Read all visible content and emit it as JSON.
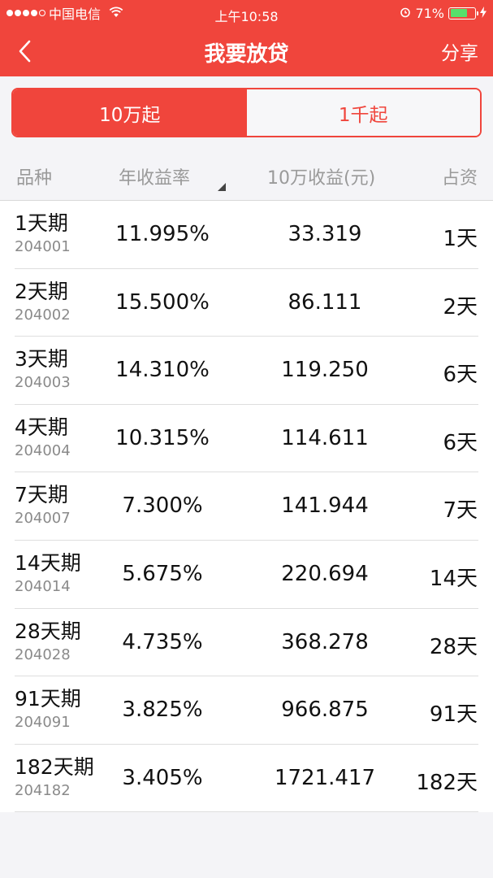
{
  "status_bar": {
    "carrier": "中国电信",
    "time": "上午10:58",
    "battery_percent": "71%",
    "battery_level": 0.71
  },
  "nav": {
    "title": "我要放贷",
    "share_label": "分享"
  },
  "segments": [
    {
      "label": "10万起",
      "active": true
    },
    {
      "label": "1千起",
      "active": false
    }
  ],
  "table": {
    "headers": {
      "variety": "品种",
      "annual_yield": "年收益率",
      "income_100k": "10万收益(元)",
      "duration": "占资"
    },
    "rows": [
      {
        "name": "1天期",
        "code": "204001",
        "rate": "11.995%",
        "income": "33.319",
        "days": "1天"
      },
      {
        "name": "2天期",
        "code": "204002",
        "rate": "15.500%",
        "income": "86.111",
        "days": "2天"
      },
      {
        "name": "3天期",
        "code": "204003",
        "rate": "14.310%",
        "income": "119.250",
        "days": "6天"
      },
      {
        "name": "4天期",
        "code": "204004",
        "rate": "10.315%",
        "income": "114.611",
        "days": "6天"
      },
      {
        "name": "7天期",
        "code": "204007",
        "rate": "7.300%",
        "income": "141.944",
        "days": "7天"
      },
      {
        "name": "14天期",
        "code": "204014",
        "rate": "5.675%",
        "income": "220.694",
        "days": "14天"
      },
      {
        "name": "28天期",
        "code": "204028",
        "rate": "4.735%",
        "income": "368.278",
        "days": "28天"
      },
      {
        "name": "91天期",
        "code": "204091",
        "rate": "3.825%",
        "income": "966.875",
        "days": "91天"
      },
      {
        "name": "182天期",
        "code": "204182",
        "rate": "3.405%",
        "income": "1721.417",
        "days": "182天"
      }
    ]
  },
  "colors": {
    "brand_red": "#f0453c",
    "background": "#f4f4f7"
  }
}
